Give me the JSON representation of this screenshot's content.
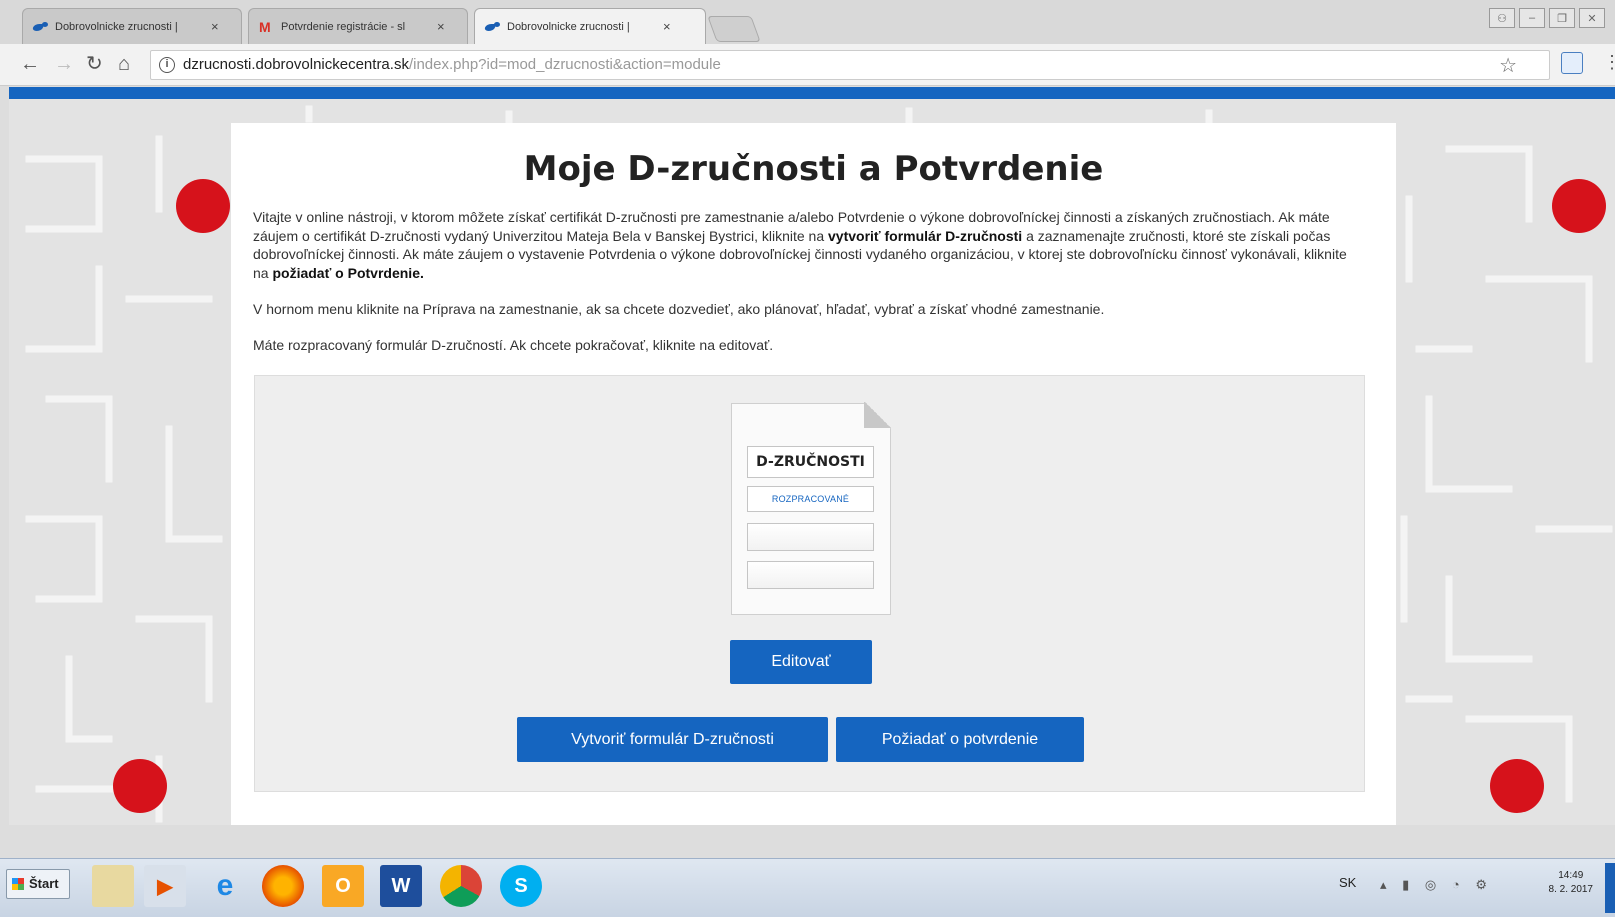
{
  "browser": {
    "tabs": [
      {
        "label": "Dobrovolnicke zrucnosti |",
        "favicon": "dobrovolnicke-centra-icon",
        "active": false
      },
      {
        "label": "Potvrdenie registrácie - sl",
        "favicon": "gmail-icon",
        "active": false
      },
      {
        "label": "Dobrovolnicke zrucnosti |",
        "favicon": "dobrovolnicke-centra-icon",
        "active": true
      }
    ],
    "tab_close": "×",
    "address": {
      "host": "dzrucnosti.dobrovolnickecentra.sk",
      "path": "/index.php?id=mod_dzrucnosti&action=module"
    }
  },
  "page": {
    "title": "Moje D-zručnosti a Potvrdenie",
    "intro": {
      "part1": "Vitajte v online nástroji, v ktorom môžete získať certifikát D-zručnosti pre zamestnanie a/alebo Potvrdenie o výkone dobrovoľníckej činnosti a získaných zručnostiach. Ak máte záujem o certifikát D-zručnosti vydaný Univerzitou Mateja Bela v Banskej Bystrici, kliknite na ",
      "bold1": "vytvoriť formulár D-zručnosti",
      "part2": " a zaznamenajte zručnosti, ktoré ste získali počas dobrovoľníckej činnosti. Ak máte záujem o vystavenie Potvrdenia o výkone dobrovoľníckej činnosti vydaného organizáciou, v ktorej ste dobrovoľnícku činnosť vykonávali, kliknite na ",
      "bold2": "požiadať o Potvrdenie."
    },
    "para2": "V hornom menu kliknite na Príprava na zamestnanie, ak sa chcete dozvedieť, ako plánovať, hľadať, vybrať a získať vhodné zamestnanie.",
    "para3": "Máte rozpracovaný formulár D-zručností. Ak chcete pokračovať, kliknite na editovať.",
    "document": {
      "title": "D-ZRUČNOSTI",
      "status": "ROZPRACOVANÉ"
    },
    "buttons": {
      "edit": "Editovať",
      "create": "Vytvoriť formulár D-zručnosti",
      "request": "Požiadať o potvrdenie"
    }
  },
  "taskbar": {
    "start_label": "Štart",
    "language": "SK",
    "time": "14:49",
    "date": "8. 2. 2017"
  },
  "colors": {
    "brand_blue": "#1565c0",
    "dot_red": "#d6121b"
  }
}
